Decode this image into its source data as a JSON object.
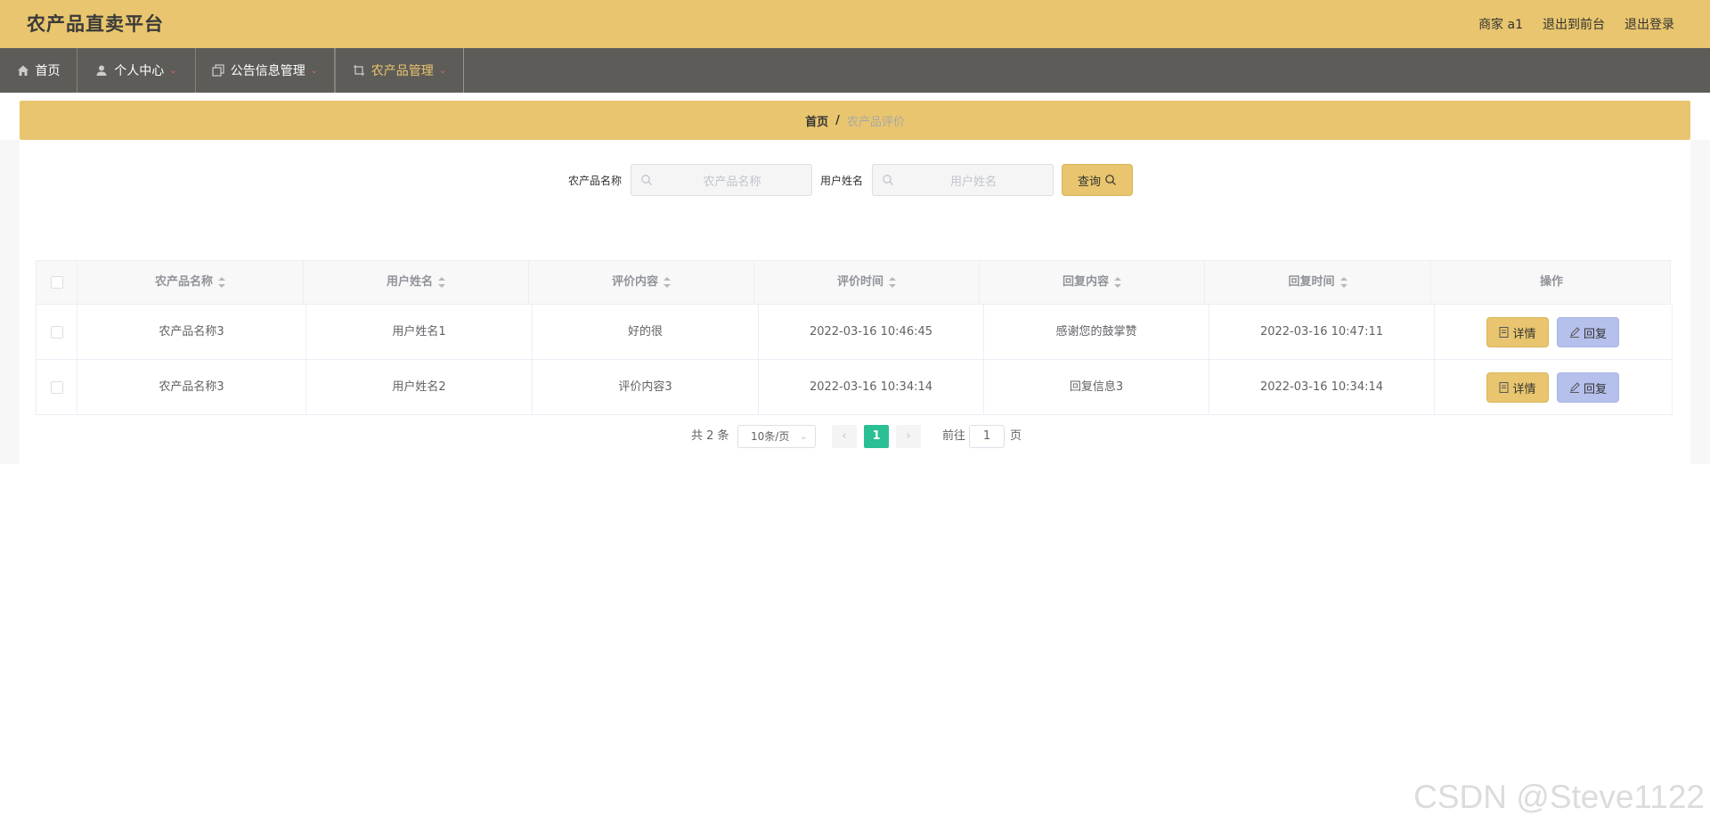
{
  "header": {
    "title": "农产品直卖平台",
    "user": "商家 a1",
    "to_front": "退出到前台",
    "logout": "退出登录"
  },
  "nav": [
    {
      "label": "首页",
      "icon": "home-icon"
    },
    {
      "label": "个人中心",
      "icon": "user-icon"
    },
    {
      "label": "公告信息管理",
      "icon": "copy-icon"
    },
    {
      "label": "农产品管理",
      "icon": "crop-icon"
    }
  ],
  "breadcrumb": {
    "home": "首页",
    "separator": "/",
    "current": "农产品评价"
  },
  "search": {
    "product_label": "农产品名称",
    "product_placeholder": "农产品名称",
    "user_label": "用户姓名",
    "user_placeholder": "用户姓名",
    "query_label": "查询"
  },
  "table": {
    "columns": [
      "农产品名称",
      "用户姓名",
      "评价内容",
      "评价时间",
      "回复内容",
      "回复时间",
      "操作"
    ],
    "rows": [
      {
        "product": "农产品名称3",
        "user": "用户姓名1",
        "content": "好的很",
        "time": "2022-03-16 10:46:45",
        "reply": "感谢您的鼓掌赞",
        "reply_time": "2022-03-16 10:47:11"
      },
      {
        "product": "农产品名称3",
        "user": "用户姓名2",
        "content": "评价内容3",
        "time": "2022-03-16 10:34:14",
        "reply": "回复信息3",
        "reply_time": "2022-03-16 10:34:14"
      }
    ],
    "detail_label": "详情",
    "reply_label": "回复"
  },
  "pagination": {
    "total": "共 2 条",
    "page_size": "10条/页",
    "current_page": "1",
    "goto_label": "前往",
    "goto_value": "1",
    "page_suffix": "页"
  },
  "watermark": "CSDN @Steve1122",
  "colors": {
    "header": "#e8c56e",
    "nav": "#5e5c59",
    "accent_active": "#e8c56e",
    "detail_button": "#e8c56e",
    "reply_button": "#b6c0ec",
    "page_active": "#2bbf95"
  }
}
